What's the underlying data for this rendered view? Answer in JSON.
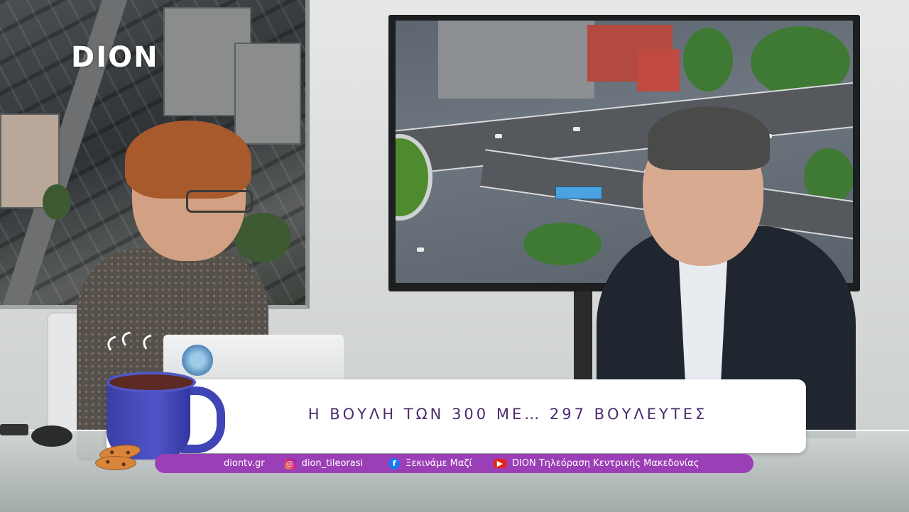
{
  "brand": {
    "logo_text": "DION"
  },
  "lower_third": {
    "headline": "Η ΒΟΥΛΗ ΤΩΝ 300 ΜΕ… 297 ΒΟΥΛΕΥΤΕΣ"
  },
  "social_bar": {
    "items": [
      {
        "icon": "none",
        "label": "diontv.gr"
      },
      {
        "icon": "instagram-icon",
        "label": "dion_tileorasi"
      },
      {
        "icon": "facebook-icon",
        "label": "Ξεκινάμε Μαζί"
      },
      {
        "icon": "youtube-icon",
        "label": "DION Τηλεόραση Κεντρικής Μακεδονίας"
      }
    ]
  },
  "colors": {
    "social_bar_bg": "#9b3fb6",
    "headline_text": "#4b2a6e",
    "headline_bg": "#ffffff"
  }
}
